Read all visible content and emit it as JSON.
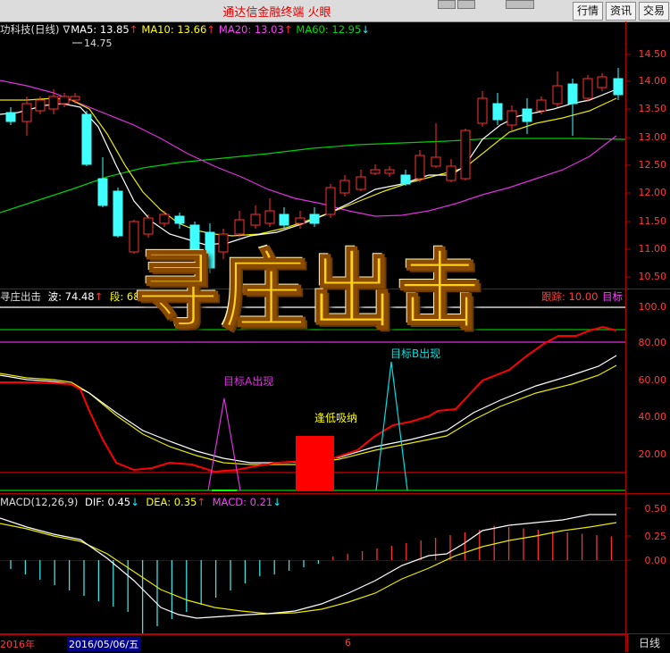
{
  "window": {
    "title": "通达信金融终端  火眼",
    "buttons": [
      "行情",
      "资讯",
      "交易"
    ]
  },
  "main_panel": {
    "stock_label": "功科技(日线)",
    "marker": "∇",
    "ma": [
      {
        "label": "MA5: 13.85",
        "arrow": "↑",
        "color": "#ffffff"
      },
      {
        "label": "MA10: 13.66",
        "arrow": "↑",
        "color": "#ffff00"
      },
      {
        "label": "MA20: 13.03",
        "arrow": "↑",
        "color": "#ff40ff"
      },
      {
        "label": "MA60: 12.95",
        "arrow": "↓",
        "color": "#00e000"
      }
    ],
    "high_mark": "14.75",
    "y_ticks": [
      "14.50",
      "14.00",
      "13.50",
      "13.00",
      "12.50",
      "12.00",
      "11.50",
      "11.00",
      "10.50"
    ]
  },
  "overlay_title": "寻庄出击",
  "indicator_panel": {
    "name": "寻庄出击",
    "values": [
      {
        "label": "波: 74.48",
        "arrow": "↑",
        "color": "#ffffff"
      },
      {
        "label": "段: 68.1",
        "arrow": "",
        "color": "#ffff00"
      },
      {
        "label": ".00",
        "arrow": "",
        "color": "#ffffff"
      },
      {
        "label": "跟踪: 10.00",
        "arrow": "",
        "color": "#ff4040"
      },
      {
        "label": "目标",
        "arrow": "",
        "color": "#ff40ff"
      }
    ],
    "y_ticks": [
      "100.0",
      "80.00",
      "60.00",
      "40.00",
      "20.00"
    ],
    "annotations": {
      "target_a": "目标A出现",
      "low_buy": "逢低吸纳",
      "target_b": "目标B出现"
    }
  },
  "macd_panel": {
    "title": "MACD(12,26,9)",
    "dif": "DIF: 0.45",
    "dif_arrow": "↓",
    "dea": "DEA: 0.35",
    "dea_arrow": "↑",
    "macd": "MACD: 0.21",
    "macd_arrow": "↓",
    "y_ticks": [
      "0.50",
      "0.25",
      "0.00"
    ]
  },
  "date_bar": {
    "year": "2016年",
    "cursor_date": "2016/05/06/五",
    "month_mark": "6",
    "period": "日线"
  }
}
